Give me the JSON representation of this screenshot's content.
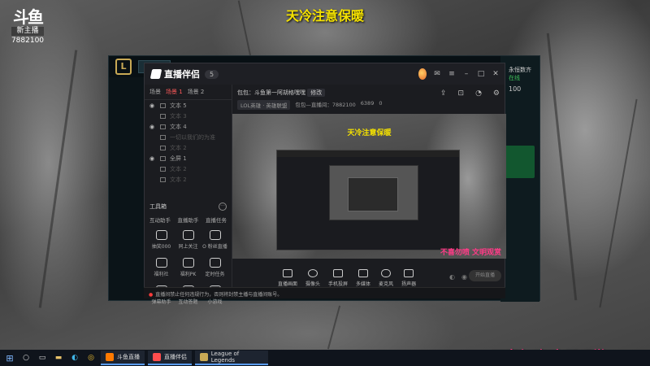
{
  "overlay": {
    "platform_logo": "斗鱼",
    "platform_tag": "新主播",
    "room_id": "7882100",
    "top_caption": "天冷注意保暖",
    "bottom_caption": "不喜勿喷 文明观赏"
  },
  "lol_client": {
    "logo": "L",
    "coins": "100",
    "player_name": "永恒数齐",
    "status": "在线"
  },
  "app": {
    "name": "直播伴侣",
    "version": "5",
    "scene_tabs": [
      "场景",
      "场景 1",
      "场景 2"
    ],
    "active_scene_tab": 1,
    "sources": [
      {
        "label": "文本 5",
        "dim": false
      },
      {
        "label": "文本 3",
        "dim": true
      },
      {
        "label": "文本 4",
        "dim": false
      },
      {
        "label": "一切以我们的为准",
        "dim": true
      },
      {
        "label": "文本 2",
        "dim": true
      },
      {
        "label": "全屏 1",
        "dim": false
      },
      {
        "label": "文本 2",
        "dim": true
      },
      {
        "label": "文本 2",
        "dim": true
      }
    ],
    "tools_title": "工具箱",
    "tools_tabs": [
      "互动助手",
      "直播助手",
      "直播任务"
    ],
    "tools": [
      "抽奖000",
      "同上关注",
      "O 粉丝直播",
      "福利社",
      "福利PK",
      "定时任务",
      "弹幕助手",
      "互动答题",
      "小游戏"
    ],
    "stream_title": "包包：斗鱼第一阿胡格嘿嘿",
    "stream_edit": "修改",
    "stream_category": "LOL英雄 · 英雄联盟",
    "stream_room": "包包—直播间：7882100",
    "stream_heat": "6389",
    "stream_viewers": "0",
    "preview_caption": "天冷注意保暖",
    "preview_bottom_caption": "不喜勿喷 文明观赏",
    "bottom_tools": [
      "直播画面",
      "摄像头",
      "手机投屏",
      "多媒体",
      "麦克风",
      "扬声器"
    ],
    "go_live": "开始直播",
    "notice": "直播间禁止任何违规行为，否则将封禁主播与直播间账号。"
  },
  "taskbar": {
    "apps": [
      "斗鱼直播",
      "直播伴侣",
      "League of Legends"
    ]
  }
}
